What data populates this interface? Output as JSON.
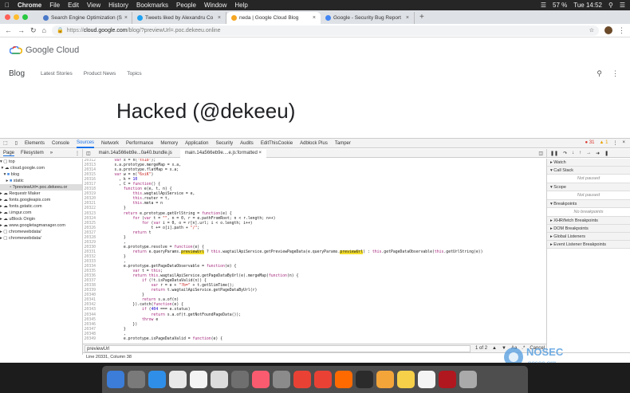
{
  "menubar": {
    "app": "Chrome",
    "items": [
      "File",
      "Edit",
      "View",
      "History",
      "Bookmarks",
      "People",
      "Window",
      "Help"
    ],
    "battery": "57 %",
    "time": "Tue 14:52"
  },
  "tabs": [
    {
      "label": "Search Engine Optimization (S",
      "color": "#4a79c9"
    },
    {
      "label": "Tweets liked by Alexandru Co",
      "color": "#1da1f2"
    },
    {
      "label": "neda | Google Cloud Blog",
      "color": "#f5a623"
    },
    {
      "label": "Google - Security Bug Report",
      "color": "#4285f4"
    }
  ],
  "url": {
    "prefix": "https://",
    "domain": "cloud.google.com",
    "path": "/blog/?previewUrl=.poc.dekeeu.online"
  },
  "page": {
    "logo": "Google Cloud",
    "blog": "Blog",
    "nav": [
      "Latest Stories",
      "Product News",
      "Topics"
    ],
    "heading": "Hacked (@dekeeu)"
  },
  "devtools": {
    "tabs": [
      "Elements",
      "Console",
      "Sources",
      "Network",
      "Performance",
      "Memory",
      "Application",
      "Security",
      "Audits",
      "EditThisCookie",
      "Adblock Plus",
      "Tamper"
    ],
    "active_tab": "Sources",
    "errors": "31",
    "warnings": "1",
    "nav_tabs": [
      "Page",
      "Filesystem"
    ],
    "file_tabs": [
      "main.14a566eb9e...0a40.bundle.js",
      "main.14a566eb9e....e.js:formatted"
    ],
    "tree": [
      "top",
      "cloud.google.com",
      "blog",
      "static",
      "?previewUrl=.poc.dekeeu.or",
      "Requestr Maker",
      "fonts.googleapis.com",
      "fonts.gstatic.com",
      "i.imgur.com",
      "uBlock Origin",
      "www.googletagmanager.com",
      "chromewebdata/",
      "chromewebdata/"
    ],
    "search_value": "previewUrl",
    "search_count": "1 of 2",
    "search_aa": "Aa",
    "search_cancel": "Cancel",
    "status": "Line 20331, Column 38",
    "side": [
      {
        "h": "Watch",
        "e": ""
      },
      {
        "h": "Call Stack",
        "e": "Not paused"
      },
      {
        "h": "Scope",
        "e": "Not paused"
      },
      {
        "h": "Breakpoints",
        "e": "No breakpoints"
      },
      {
        "h": "XHR/fetch Breakpoints",
        "e": ""
      },
      {
        "h": "DOM Breakpoints",
        "e": ""
      },
      {
        "h": "Global Listeners",
        "e": ""
      },
      {
        "h": "Event Listener Breakpoints",
        "e": ""
      }
    ],
    "code_start": 20312,
    "code": [
      "      var x = n(\"ts1b\");",
      "      s.a.prototype.mergeMap = x.a,",
      "      s.a.prototype.flatMap = x.a;",
      "      var w = n(\"6xiK\")",
      "        , k = 10",
      "        , C = function() {",
      "          function e(e, t, n) {",
      "              this.wagtailApiService = e,",
      "              this.router = t,",
      "              this.meta = n",
      "          }",
      "          return e.prototype.getUrlString = function(e) {",
      "              for (var t = \"\", n = 0, r = e.pathFromRoot; n < r.length; n++)",
      "                  for (var i = 0, o = r[n].url; i < o.length; i++)",
      "                      t += o[i].path + \"/\";",
      "              return t",
      "          }",
      "          ,",
      "          e.prototype.resolve = function(e) {",
      "              return e.queryParams.previewUrl ? this.wagtailApiService.getPreviewPageData(e.queryParams.previewUrl) : this.getPageDataObservable(this.getUrlString(e))",
      "          }",
      "          ,",
      "          e.prototype.getPageDataObservable = function(e) {",
      "              var t = this;",
      "              return this.wagtailApiService.getPageDataByUrl(e).mergeMap(function(n) {",
      "                  if (!t.isPageDataValid(n)) {",
      "                      var r = e + \"?b=\" + t.getSlimTime();",
      "                      return t.wagtailApiService.getPageDataByUrl(r)",
      "                  }",
      "                  return s.a.of(n)",
      "              }).catch(function(e) {",
      "                  if (404 === e.status)",
      "                      return s.a.of(t.getNotFoundPageData());",
      "                  throw e",
      "              })",
      "          }",
      "          ,",
      "          e.prototype.isPageDataValid = function(e) {"
    ]
  },
  "nosec": {
    "title": "NOSEC",
    "sub": "nosec.org"
  },
  "dock": [
    "#3b7dd8",
    "#7a7a7a",
    "#2f8fe8",
    "#e9e9e9",
    "#f4f4f4",
    "#dcdcdc",
    "#6f6f6f",
    "#fb5b6f",
    "#8b8b8b",
    "#e94235",
    "#e94235",
    "#ff6a00",
    "#2b2b2b",
    "#f3a53a",
    "#f7d04a",
    "#f4f4f4",
    "#b0171f",
    "#aaaaaa"
  ]
}
